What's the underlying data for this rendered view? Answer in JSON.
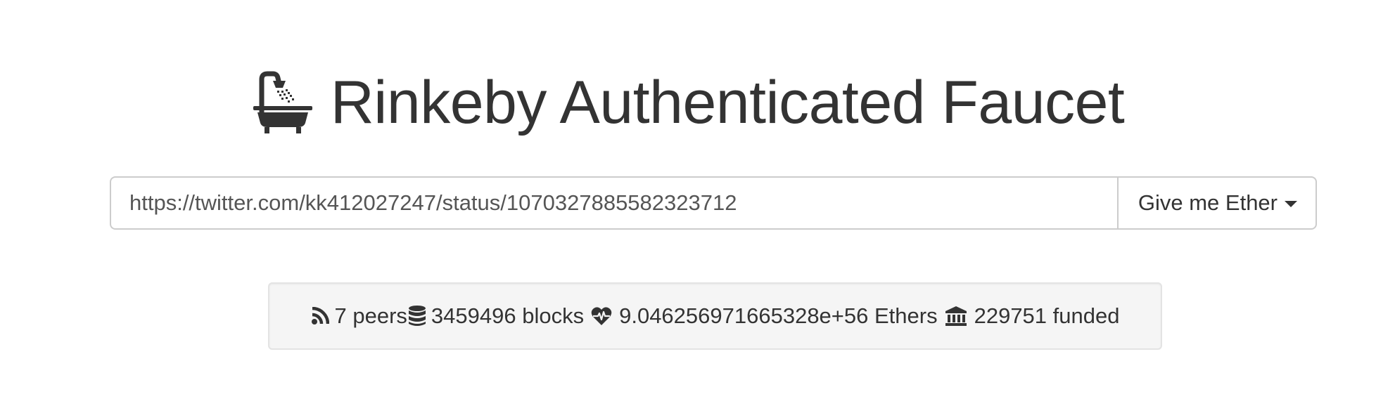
{
  "header": {
    "title": "Rinkeby Authenticated Faucet",
    "icon": "bathtub-shower-icon"
  },
  "request_form": {
    "url_value": "https://twitter.com/kk412027247/status/1070327885582323712",
    "button_label": "Give me Ether"
  },
  "stats": {
    "peers": {
      "icon": "rss-icon",
      "text": "7 peers"
    },
    "blocks": {
      "icon": "database-icon",
      "text": "3459496 blocks"
    },
    "funds": {
      "icon": "heartbeat-icon",
      "text": "9.046256971665328e+56 Ethers"
    },
    "funded": {
      "icon": "bank-icon",
      "text": "229751 funded"
    }
  },
  "colors": {
    "text": "#333333",
    "border": "#cccccc",
    "well_bg": "#f5f5f5"
  }
}
